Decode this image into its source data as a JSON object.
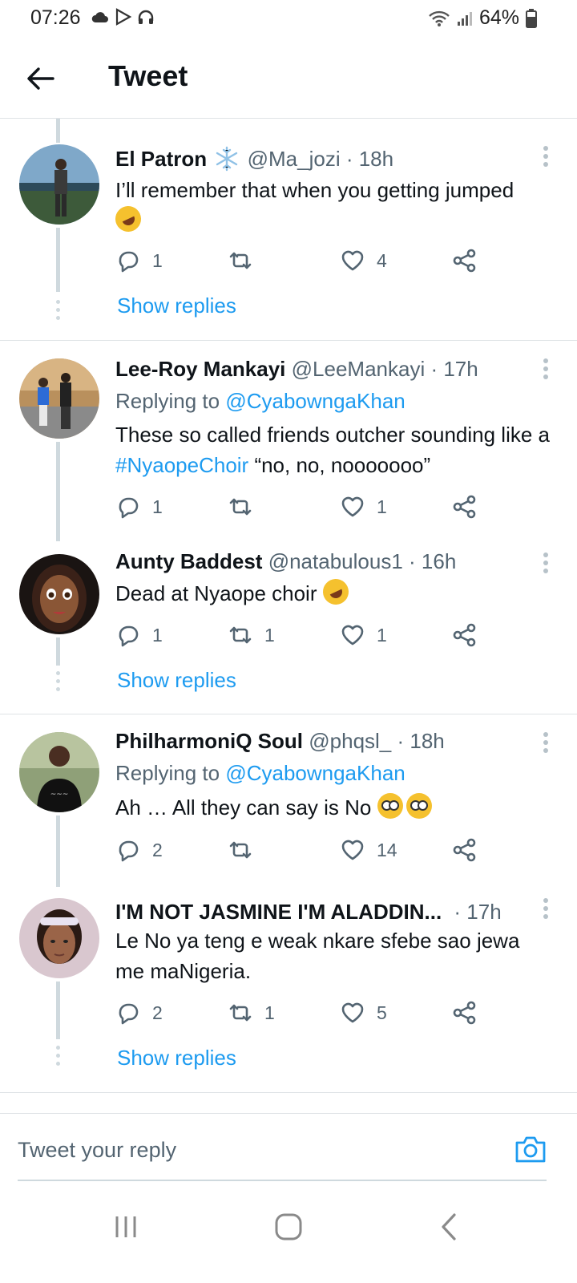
{
  "status_bar": {
    "time": "07:26",
    "battery": "64%"
  },
  "appbar": {
    "title": "Tweet"
  },
  "tweets": [
    {
      "name": "El Patron",
      "handle": "@Ma_jozi",
      "time": "· 18h",
      "body": "I’ll remember that when you getting jumped",
      "replies": "1",
      "retweets": "",
      "likes": "4",
      "show_replies": "Show replies"
    },
    {
      "name": "Lee-Roy Mankayi",
      "handle": "@LeeMankayi",
      "time": "· 17h",
      "replying_prefix": "Replying to",
      "replying_to": "@CyabowngaKhan",
      "body_pre": "These so called friends outcher sounding like a ",
      "hashtag": "#NyaopeChoir",
      "body_post": " “no, no, nooooooo”",
      "replies": "1",
      "retweets": "",
      "likes": "1"
    },
    {
      "name": "Aunty Baddest",
      "handle": "@natabulous1",
      "time": "· 16h",
      "body": "Dead at Nyaope choir",
      "replies": "1",
      "retweets": "1",
      "likes": "1",
      "show_replies": "Show replies"
    },
    {
      "name": "PhilharmoniQ Soul",
      "handle": "@phqsl_",
      "time": "· 18h",
      "replying_prefix": "Replying to",
      "replying_to": "@CyabowngaKhan",
      "body": "Ah … All they can say is No",
      "replies": "2",
      "retweets": "",
      "likes": "14"
    },
    {
      "name": "I'M NOT JASMINE I'M ALADDIN...",
      "handle": "",
      "time": "· 17h",
      "body": "Le No ya teng e weak nkare sfebe sao jewa me maNigeria.",
      "replies": "2",
      "retweets": "1",
      "likes": "5",
      "show_replies": "Show replies"
    }
  ],
  "composer": {
    "placeholder": "Tweet your reply"
  },
  "colors": {
    "accent": "#1d9bf0",
    "text": "#0f1419",
    "muted": "#536471",
    "divider": "#dfe3e6"
  },
  "icons": [
    "back-arrow-icon",
    "reply-icon",
    "retweet-icon",
    "like-icon",
    "share-icon",
    "more-icon",
    "camera-icon",
    "recents-icon",
    "home-icon",
    "nav-back-icon"
  ]
}
